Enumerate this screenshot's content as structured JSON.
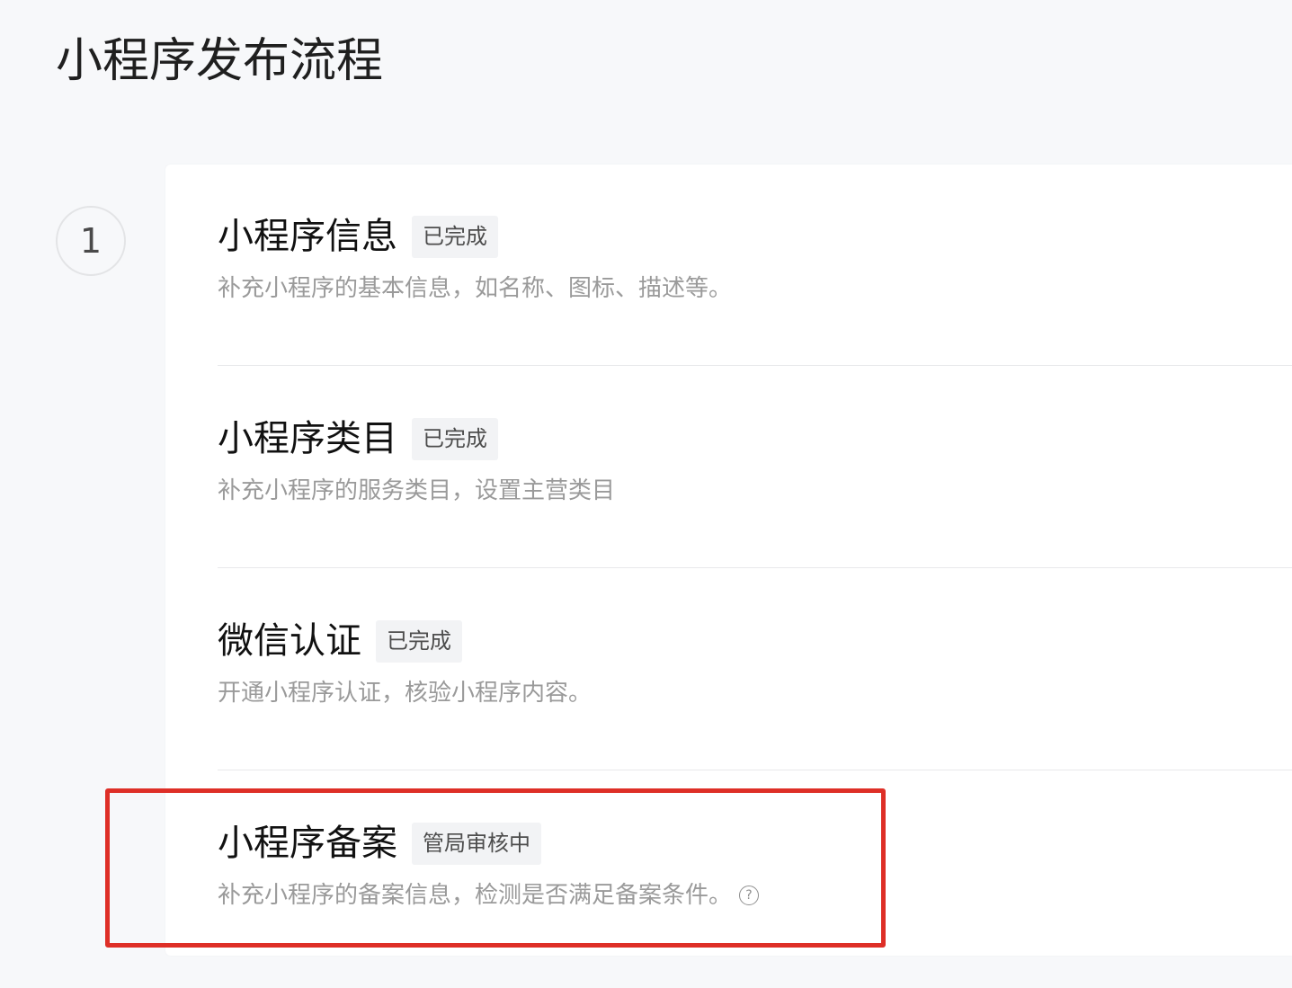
{
  "page": {
    "title": "小程序发布流程"
  },
  "step": {
    "number": "1"
  },
  "sections": [
    {
      "title": "小程序信息",
      "status": "已完成",
      "description": "补充小程序的基本信息，如名称、图标、描述等。"
    },
    {
      "title": "小程序类目",
      "status": "已完成",
      "description": "补充小程序的服务类目，设置主营类目"
    },
    {
      "title": "微信认证",
      "status": "已完成",
      "description": "开通小程序认证，核验小程序内容。"
    },
    {
      "title": "小程序备案",
      "status": "管局审核中",
      "description": "补充小程序的备案信息，检测是否满足备案条件。",
      "help_icon": "question-circle-icon"
    }
  ],
  "annotation": {
    "highlight_color": "#de2f27"
  }
}
